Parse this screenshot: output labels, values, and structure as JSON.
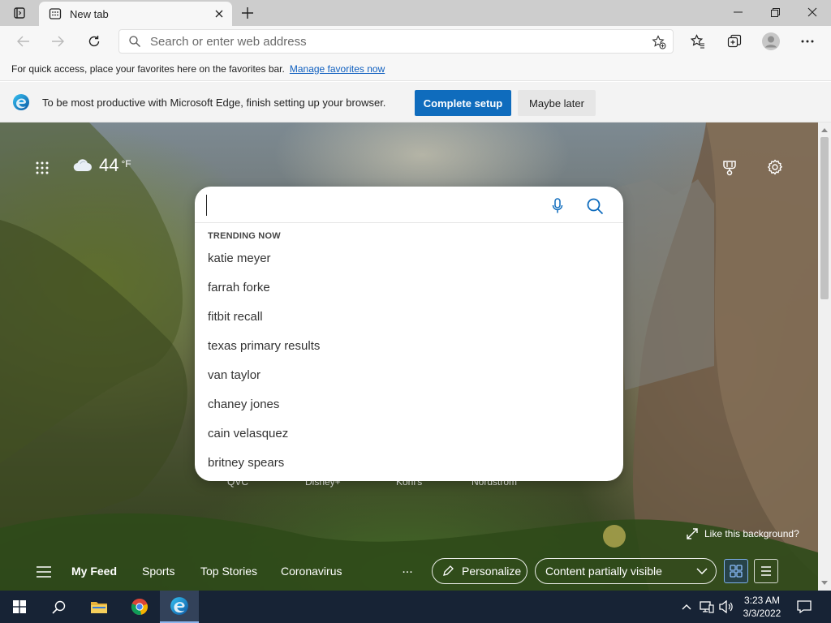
{
  "browser": {
    "tab": {
      "title": "New tab"
    },
    "address_bar": {
      "placeholder": "Search or enter web address",
      "value": ""
    },
    "favorites_bar": {
      "text": "For quick access, place your favorites here on the favorites bar.",
      "link": "Manage favorites now"
    },
    "setup_banner": {
      "text": "To be most productive with Microsoft Edge, finish setting up your browser.",
      "primary_button": "Complete setup",
      "secondary_button": "Maybe later"
    }
  },
  "ntp": {
    "weather": {
      "temperature": "44",
      "unit": "°F",
      "icon": "cloud-icon"
    },
    "search": {
      "value": "",
      "trending_heading": "TRENDING NOW",
      "trending": [
        "katie meyer",
        "farrah forke",
        "fitbit recall",
        "texas primary results",
        "van taylor",
        "chaney jones",
        "cain velasquez",
        "britney spears"
      ]
    },
    "quick_links": [
      "QVC",
      "Disney+",
      "Kohl's",
      "Nordstrom"
    ],
    "like_background": "Like this background?",
    "feed": {
      "tabs": [
        "My Feed",
        "Sports",
        "Top Stories",
        "Coronavirus"
      ],
      "more": "...",
      "personalize": "Personalize",
      "visibility": "Content partially visible"
    }
  },
  "taskbar": {
    "time": "3:23 AM",
    "date": "3/3/2022",
    "colors": {
      "background": "#172335",
      "accent": "#8cb4ec"
    }
  },
  "colors": {
    "primary_button": "#0f6cbd",
    "link": "#0f5fbf"
  }
}
